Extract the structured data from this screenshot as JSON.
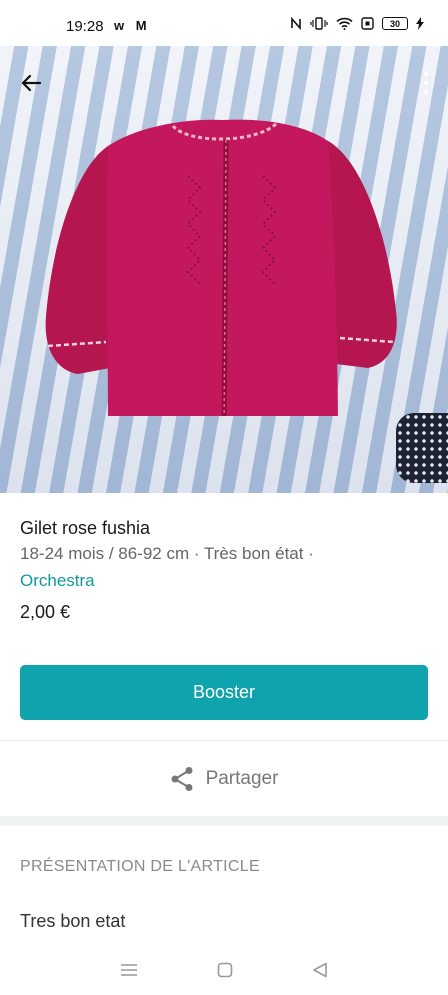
{
  "status_bar": {
    "time": "19:28",
    "left_icons": "w M",
    "battery": "30"
  },
  "header": {
    "back_icon": "arrow-left-icon",
    "menu_icon": "more-vertical-icon"
  },
  "item": {
    "title": "Gilet rose fushia",
    "meta": "18-24 mois / 86-92 cm · Très bon état ·",
    "brand": "Orchestra",
    "price": "2,00 €"
  },
  "actions": {
    "boost_label": "Booster",
    "share_label": "Partager",
    "share_icon": "share-icon"
  },
  "details": {
    "section_title": "PRÉSENTATION DE L'ARTICLE",
    "description": "Tres bon etat"
  },
  "colors": {
    "accent": "#0fa3ad",
    "brand_link": "#109a9f",
    "sweater": "#c4185e"
  }
}
